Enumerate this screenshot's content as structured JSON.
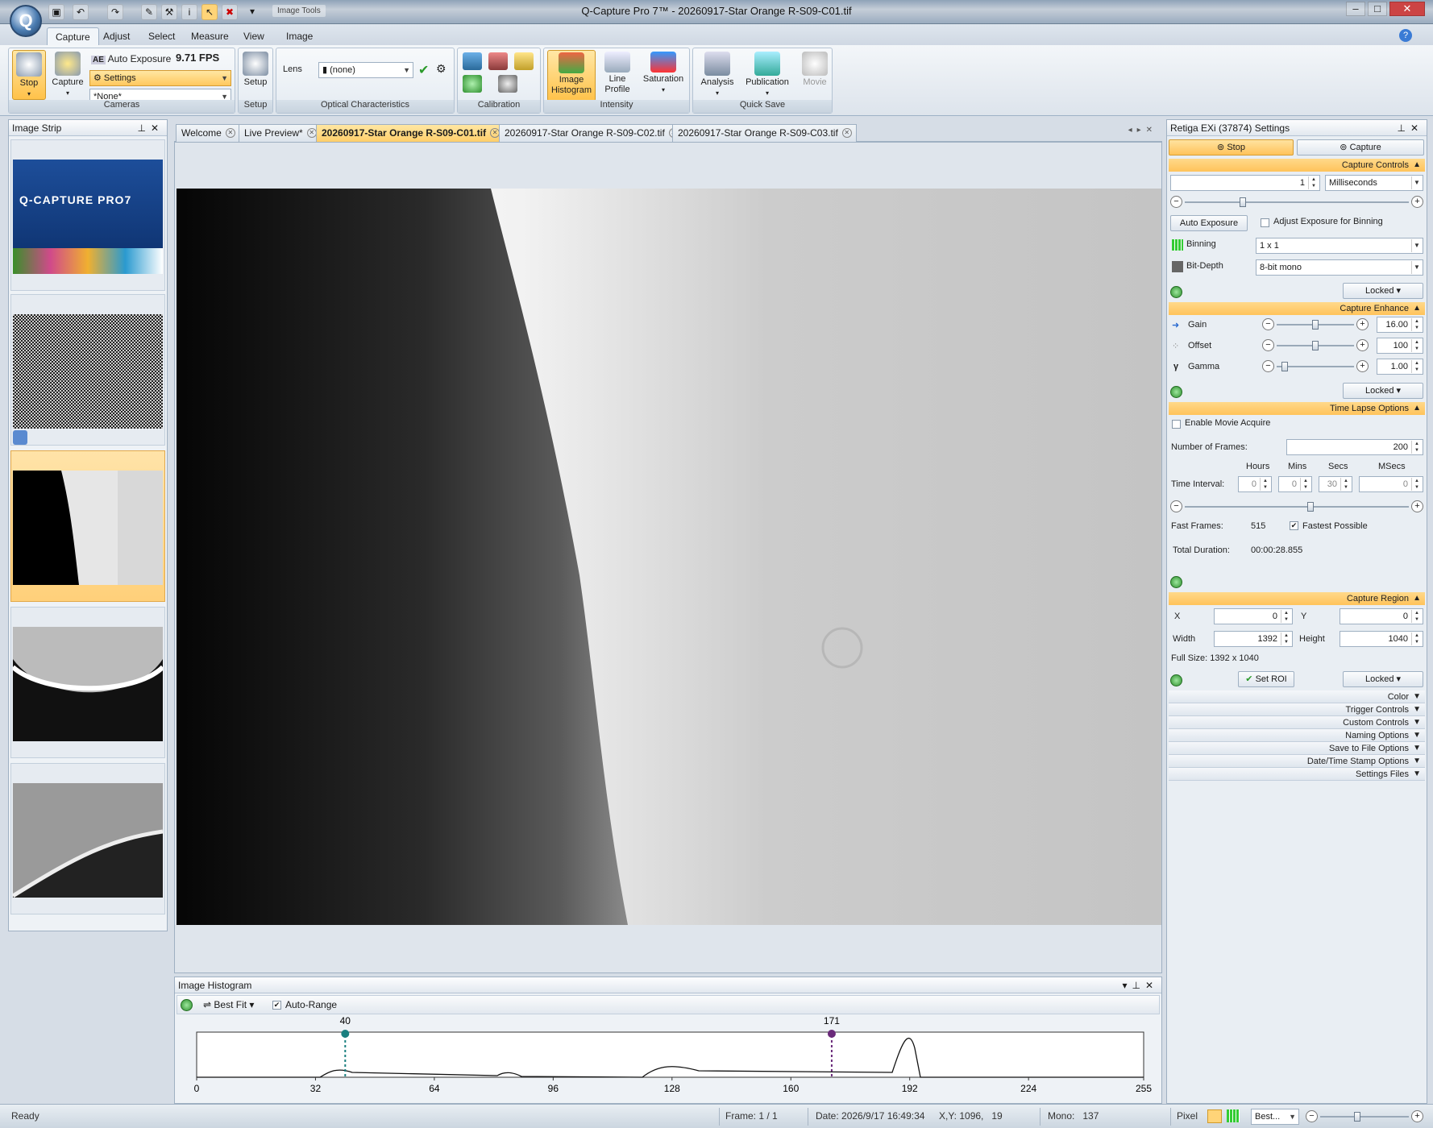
{
  "window": {
    "title": "Q-Capture Pro 7™ - 20260917-Star Orange R-S09-C01.tif",
    "image_tools": "Image Tools",
    "app_logo": "Q"
  },
  "ribbon_tabs": [
    "Capture",
    "Adjust",
    "Select",
    "Measure",
    "View",
    "Image"
  ],
  "ribbon": {
    "stop": "Stop",
    "capture": "Capture",
    "auto_exposure": "Auto Exposure",
    "ae_badge": "AE",
    "fps": "9.71 FPS",
    "settings": "Settings",
    "preset": "*None*",
    "cameras_group": "Cameras",
    "setup": "Setup",
    "setup_group": "Setup",
    "lens_label": "Lens",
    "lens_value": "(none)",
    "optical_group": "Optical Characteristics",
    "calibration_group": "Calibration",
    "image_histogram": "Image Histogram",
    "line_profile": "Line Profile",
    "saturation": "Saturation",
    "intensity_group": "Intensity",
    "analysis": "Analysis",
    "publication": "Publication",
    "movie": "Movie",
    "quicksave_group": "Quick Save"
  },
  "image_strip": {
    "title": "Image Strip",
    "logo_text": "Q-CAPTURE PRO7"
  },
  "doc_tabs": [
    {
      "label": "Welcome"
    },
    {
      "label": "Live Preview*"
    },
    {
      "label": "20260917-Star Orange R-S09-C01.tif"
    },
    {
      "label": "20260917-Star Orange R-S09-C02.tif"
    },
    {
      "label": "20260917-Star Orange R-S09-C03.tif"
    }
  ],
  "histogram": {
    "title": "Image Histogram",
    "best_fit": "Best Fit",
    "auto_range": "Auto-Range",
    "low_marker": "40",
    "high_marker": "171",
    "ticks": [
      "0",
      "32",
      "64",
      "96",
      "128",
      "160",
      "192",
      "224",
      "255"
    ],
    "low_value": 40,
    "high_value": 171,
    "x_max": 255
  },
  "settings": {
    "title": "Retiga EXi (37874) Settings",
    "stop_btn": "Stop",
    "capture_btn": "Capture",
    "capture_controls": "Capture Controls",
    "exposure_value": "1",
    "exposure_unit": "Milliseconds",
    "auto_exposure_btn": "Auto Exposure",
    "adjust_binning": "Adjust Exposure for Binning",
    "binning_label": "Binning",
    "binning_value": "1 x 1",
    "bitdepth_label": "Bit-Depth",
    "bitdepth_value": "8-bit mono",
    "locked": "Locked",
    "capture_enhance": "Capture Enhance",
    "gain_label": "Gain",
    "gain_value": "16.00",
    "offset_label": "Offset",
    "offset_value": "100",
    "gamma_label": "Gamma",
    "gamma_value": "1.00",
    "time_lapse": "Time Lapse Options",
    "enable_movie": "Enable Movie Acquire",
    "num_frames_label": "Number of Frames:",
    "num_frames": "200",
    "hours": "Hours",
    "mins": "Mins",
    "secs": "Secs",
    "msecs": "MSecs",
    "time_interval": "Time Interval:",
    "hours_val": "0",
    "mins_val": "0",
    "secs_val": "30",
    "msecs_val": "0",
    "fast_frames_label": "Fast Frames:",
    "fast_frames": "515",
    "fastest_possible": "Fastest Possible",
    "total_duration_label": "Total Duration:",
    "total_duration": "00:00:28.855",
    "capture_region": "Capture Region",
    "x_label": "X",
    "x_val": "0",
    "y_label": "Y",
    "y_val": "0",
    "width_label": "Width",
    "width_val": "1392",
    "height_label": "Height",
    "height_val": "1040",
    "full_size": "Full Size: 1392 x 1040",
    "set_roi": "Set ROI",
    "collapsed": [
      "Color",
      "Trigger Controls",
      "Custom Controls",
      "Naming Options",
      "Save to File Options",
      "Date/Time Stamp Options",
      "Settings Files"
    ]
  },
  "status": {
    "ready": "Ready",
    "frame": "Frame: 1 / 1",
    "date": "Date: 2026/9/17 16:49:34",
    "xy": "X,Y: 1096,   19",
    "mono": "Mono:   137",
    "pixel": "Pixel",
    "zoom": "Best..."
  }
}
